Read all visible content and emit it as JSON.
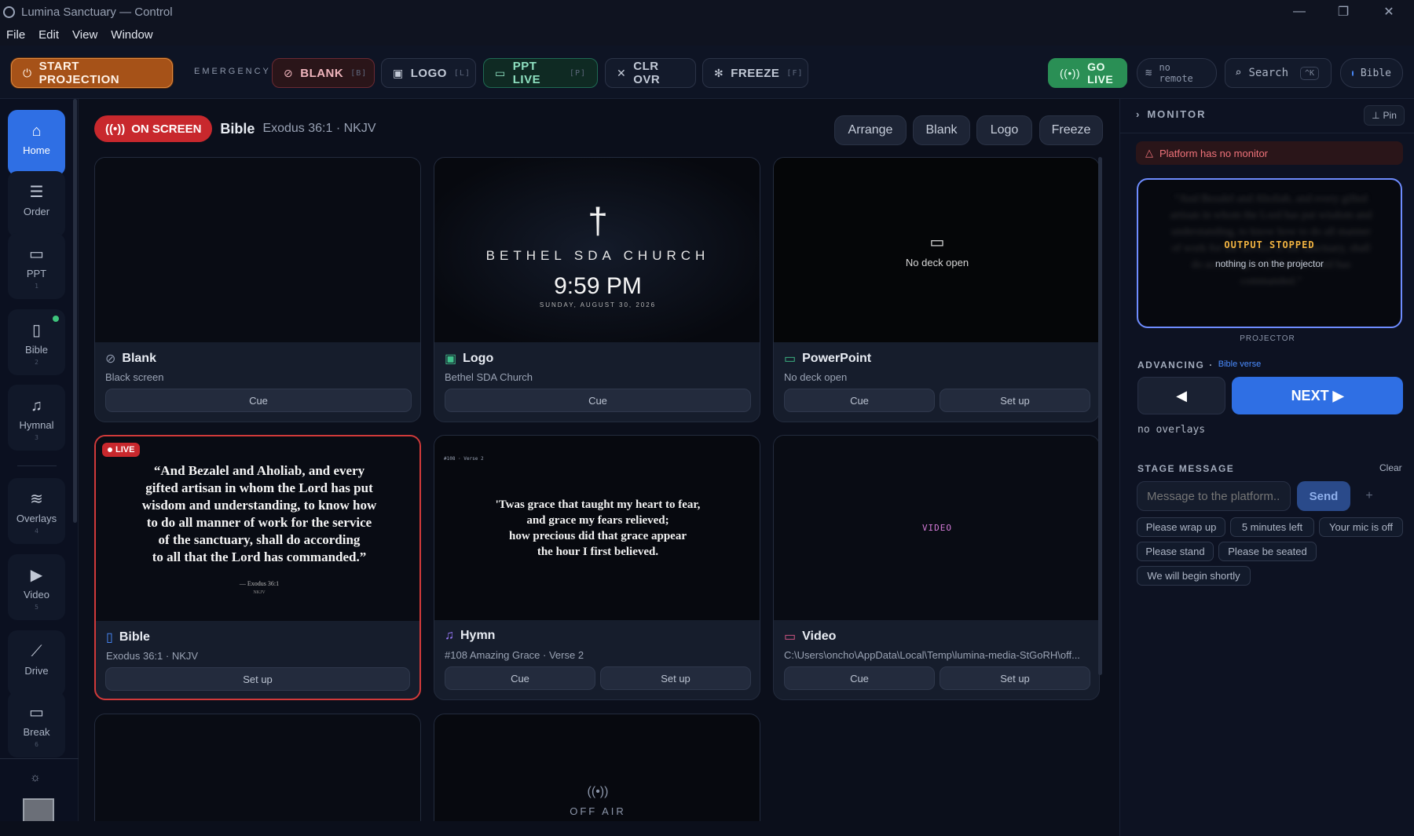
{
  "window": {
    "title": "Lumina Sanctuary — Control",
    "minimize": "—",
    "maximize": "❐",
    "close": "✕"
  },
  "menu": [
    "File",
    "Edit",
    "View",
    "Window"
  ],
  "toolbar": {
    "start": "START PROJECTION",
    "emergency": "EMERGENCY",
    "blank": {
      "label": "BLANK",
      "key": "[B]"
    },
    "logo": {
      "label": "LOGO",
      "key": "[L]"
    },
    "ppt": {
      "label": "PPT LIVE",
      "key": "[P]"
    },
    "clr": {
      "label": "CLR OVR"
    },
    "freeze": {
      "label": "FREEZE",
      "key": "[F]"
    },
    "golive": "GO LIVE",
    "noremote": "no remote",
    "search": "Search",
    "search_key": "^K",
    "bible": "Bible"
  },
  "sidebar": [
    {
      "label": "Home",
      "icon": "home-icon",
      "key": ""
    },
    {
      "label": "Order",
      "icon": "list-ordered-icon",
      "key": ""
    },
    {
      "label": "PPT",
      "icon": "monitor-icon",
      "key": "1"
    },
    {
      "label": "Bible",
      "icon": "book-icon",
      "key": "2"
    },
    {
      "label": "Hymnal",
      "icon": "music-note-icon",
      "key": "3"
    },
    {
      "label": "Overlays",
      "icon": "layers-icon",
      "key": "4"
    },
    {
      "label": "Video",
      "icon": "video-camera-icon",
      "key": "5"
    },
    {
      "label": "Drive",
      "icon": "drive-icon",
      "key": ""
    },
    {
      "label": "Break",
      "icon": "break-screen-icon",
      "key": "6"
    }
  ],
  "onscreen": {
    "badge": "ON SCREEN",
    "title": "Bible",
    "ref": "Exodus 36:1 · NKJV"
  },
  "actions": [
    "Arrange",
    "Blank",
    "Logo",
    "Freeze"
  ],
  "cards": {
    "blank": {
      "title": "Blank",
      "sub": "Black screen",
      "cue": "Cue"
    },
    "logo": {
      "title": "Logo",
      "sub": "Bethel SDA Church",
      "cue": "Cue",
      "preview": {
        "church": "BETHEL SDA CHURCH",
        "time": "9:59 PM",
        "date": "SUNDAY, AUGUST 30, 2026"
      }
    },
    "ppt": {
      "title": "PowerPoint",
      "sub": "No deck open",
      "cue": "Cue",
      "setup": "Set up",
      "preview": "No deck open"
    },
    "bible": {
      "title": "Bible",
      "sub": "Exodus 36:1 · NKJV",
      "setup": "Set up",
      "live": "LIVE",
      "preview": {
        "verse": [
          "“And Bezalel and Aholiab, and every",
          "gifted artisan in whom the Lord has put",
          "wisdom and understanding, to know how",
          "to do all manner of work for the service",
          "of the sanctuary, shall do according",
          "to all that the Lord has commanded.”"
        ],
        "ref": "— Exodus 36:1",
        "version": "NKJV"
      }
    },
    "hymn": {
      "title": "Hymn",
      "sub": "#108 Amazing Grace · Verse 2",
      "cue": "Cue",
      "setup": "Set up",
      "preview": {
        "tag": "#108 · Verse 2",
        "lines": [
          "'Twas grace that taught my heart to fear,",
          "and grace my fears relieved;",
          "how precious did that grace appear",
          "the hour I first believed."
        ]
      }
    },
    "video": {
      "title": "Video",
      "sub": "C:\\Users\\oncho\\AppData\\Local\\Temp\\lumina-media-StGoRH\\off...",
      "cue": "Cue",
      "setup": "Set up",
      "preview": "VIDEO"
    },
    "offair": {
      "preview": "OFF AIR"
    }
  },
  "monitor": {
    "label": "MONITOR",
    "pin": "Pin",
    "warning": "Platform has no monitor",
    "stopped": "OUTPUT STOPPED",
    "nothing": "nothing is on the projector",
    "ghost": "“And Bezalel and Aholiab, and every gifted artisan in whom the Lord has put wisdom and understanding, to know how to do all manner of work for the service of the sanctuary, shall do according to all that the Lord has commanded.”",
    "projector": "PROJECTOR",
    "advancing": "ADVANCING",
    "advancing_target": "Bible verse",
    "prev": "◀",
    "next": "NEXT ▶",
    "overlays": "no overlays"
  },
  "stage": {
    "label": "STAGE MESSAGE",
    "clear": "Clear",
    "placeholder": "Message to the platform...",
    "send": "Send",
    "add": "+",
    "chips": [
      "Please wrap up",
      "5 minutes left",
      "Your mic is off",
      "Please stand",
      "Please be seated",
      "We will begin shortly"
    ]
  }
}
